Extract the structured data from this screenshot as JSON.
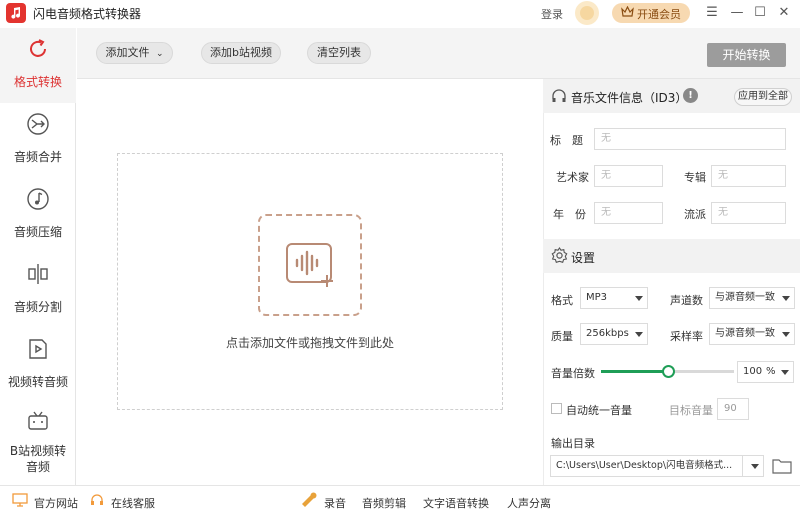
{
  "app": {
    "title": "闪电音频格式转换器",
    "login_label": "登录",
    "vip_label": "开通会员"
  },
  "window_controls": {
    "menu": "☰",
    "minimize": "—",
    "maximize": "☐",
    "close": "✕"
  },
  "sidebar": {
    "items": [
      {
        "label": "格式转换",
        "icon": "refresh-icon",
        "active": true
      },
      {
        "label": "音频合并",
        "icon": "merge-icon",
        "active": false
      },
      {
        "label": "音频压缩",
        "icon": "music-note-icon",
        "active": false
      },
      {
        "label": "音频分割",
        "icon": "split-icon",
        "active": false
      },
      {
        "label": "视频转音频",
        "icon": "video-play-icon",
        "active": false
      },
      {
        "label": "B站视频转音频",
        "icon": "bilibili-icon",
        "active": false
      }
    ]
  },
  "toolbar": {
    "add_file": "添加文件",
    "add_bilibili": "添加b站视频",
    "clear_list": "清空列表",
    "start": "开始转换"
  },
  "dropzone": {
    "text": "点击添加文件或拖拽文件到此处"
  },
  "id3": {
    "title": "音乐文件信息（ID3）",
    "apply_all": "应用到全部",
    "fields": {
      "title_label": "标　题",
      "title_placeholder": "无",
      "artist_label": "艺术家",
      "artist_placeholder": "无",
      "album_label": "专辑",
      "album_placeholder": "无",
      "year_label": "年　份",
      "year_placeholder": "无",
      "genre_label": "流派",
      "genre_placeholder": "无"
    }
  },
  "settings": {
    "title": "设置",
    "format_label": "格式",
    "format_value": "MP3",
    "channels_label": "声道数",
    "channels_value": "与源音频一致",
    "quality_label": "质量",
    "quality_value": "256kbps",
    "samplerate_label": "采样率",
    "samplerate_value": "与源音频一致",
    "volume_label": "音量倍数",
    "volume_value": "100",
    "volume_unit": "%",
    "volume_fraction": 0.5,
    "auto_volume_label": "自动统一音量",
    "target_volume_label": "目标音量",
    "target_volume_value": "90",
    "output_label": "输出目录",
    "output_path": "C:\\Users\\User\\Desktop\\闪电音频格式..."
  },
  "footer": {
    "website": "官方网站",
    "support": "在线客服",
    "record": "录音",
    "audio_edit": "音频剪辑",
    "tts": "文字语音转换",
    "vocal_sep": "人声分离"
  }
}
